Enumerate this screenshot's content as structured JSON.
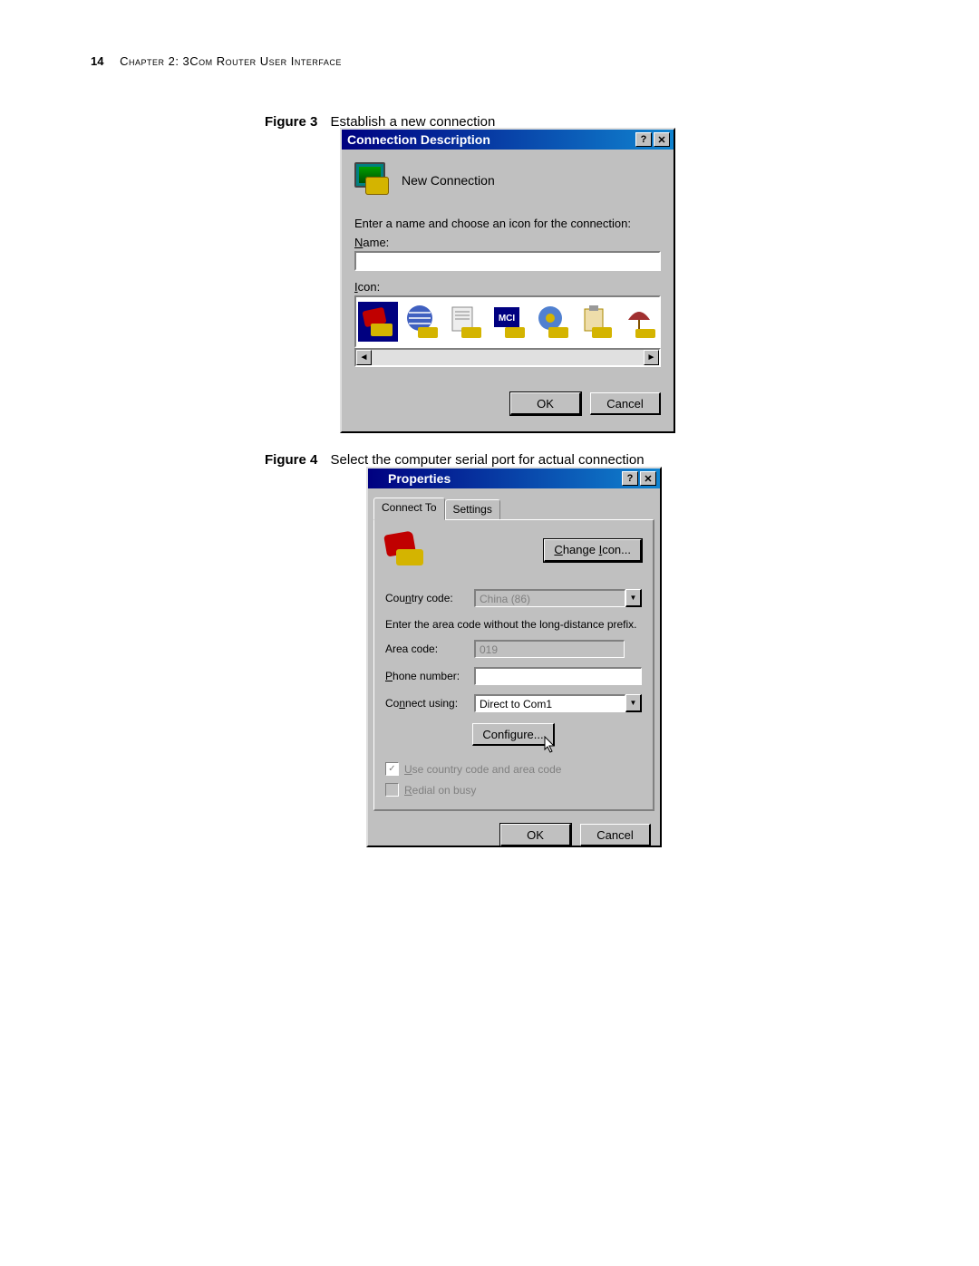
{
  "header": {
    "page_number": "14",
    "chapter": "Chapter 2: 3Com Router User Interface"
  },
  "figure3": {
    "figure_label": "Figure 3",
    "caption": "Establish a new connection",
    "title": "Connection Description",
    "new_connection": "New Connection",
    "instruction": "Enter a name and choose an icon for the connection:",
    "name_label": "Name:",
    "name_value": "",
    "icon_label": "Icon:",
    "ok": "OK",
    "cancel": "Cancel"
  },
  "figure4": {
    "figure_label": "Figure 4",
    "caption": "Select the computer serial port for actual connection",
    "title": "Properties",
    "tab_connect": "Connect To",
    "tab_settings": "Settings",
    "change_icon": "Change Icon...",
    "country_label": "Country code:",
    "country_value": "China (86)",
    "area_note": "Enter the area code without the long-distance prefix.",
    "area_label": "Area code:",
    "area_value": "019",
    "phone_label": "Phone number:",
    "phone_value": "",
    "connect_label": "Connect using:",
    "connect_value": "Direct to Com1",
    "configure": "Configure...",
    "use_country": "Use country code and area code",
    "redial": "Redial on busy",
    "ok": "OK",
    "cancel": "Cancel"
  }
}
